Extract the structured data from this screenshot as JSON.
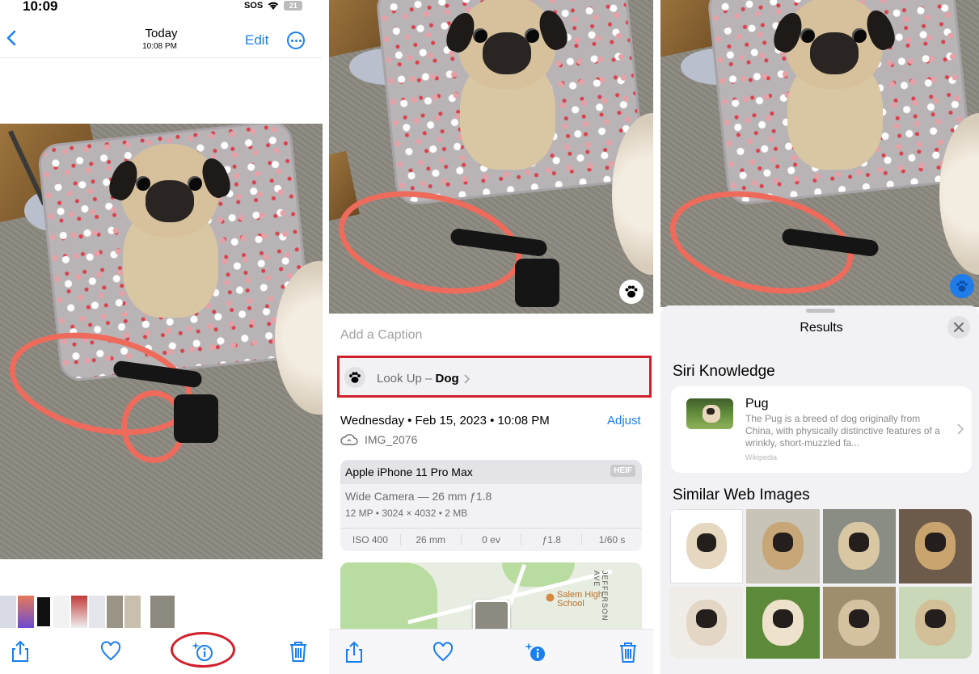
{
  "panel1": {
    "status": {
      "time": "10:09",
      "sos": "SOS",
      "battery": "21"
    },
    "nav": {
      "title": "Today",
      "subtitle": "10:08 PM",
      "edit": "Edit"
    },
    "icons": [
      "back-chevron-icon",
      "more-icon",
      "share-icon",
      "heart-icon",
      "visual-lookup-info-icon",
      "trash-icon"
    ]
  },
  "panel2": {
    "caption_placeholder": "Add a Caption",
    "lookup": {
      "prefix": "Look Up – ",
      "subject": "Dog"
    },
    "date": "Wednesday • Feb 15, 2023 • 10:08 PM",
    "adjust": "Adjust",
    "filename": "IMG_2076",
    "exif": {
      "device": "Apple iPhone 11 Pro Max",
      "format": "HEIF",
      "lens": "Wide Camera — 26 mm ƒ1.8",
      "specs": "12 MP  •  3024 × 4032  •  2 MB",
      "values": [
        "ISO 400",
        "26 mm",
        "0 ev",
        "ƒ1.8",
        "1/60 s"
      ]
    },
    "map": {
      "poi": "Salem High\nSchool",
      "street": "JEFFERSON AVE"
    }
  },
  "panel3": {
    "sheet_title": "Results",
    "siri_heading": "Siri Knowledge",
    "knowledge": {
      "title": "Pug",
      "description": "The Pug is a breed of dog originally from China, with physically distinctive features of a wrinkly, short-muzzled fa...",
      "source": "Wikipedia"
    },
    "similar_heading": "Similar Web Images",
    "similar_images": 8
  },
  "colors": {
    "accent": "#1a7ff0",
    "highlight_red": "#d11f2b",
    "leash": "#ee6b5c",
    "secondary_text": "#6d6d72"
  }
}
